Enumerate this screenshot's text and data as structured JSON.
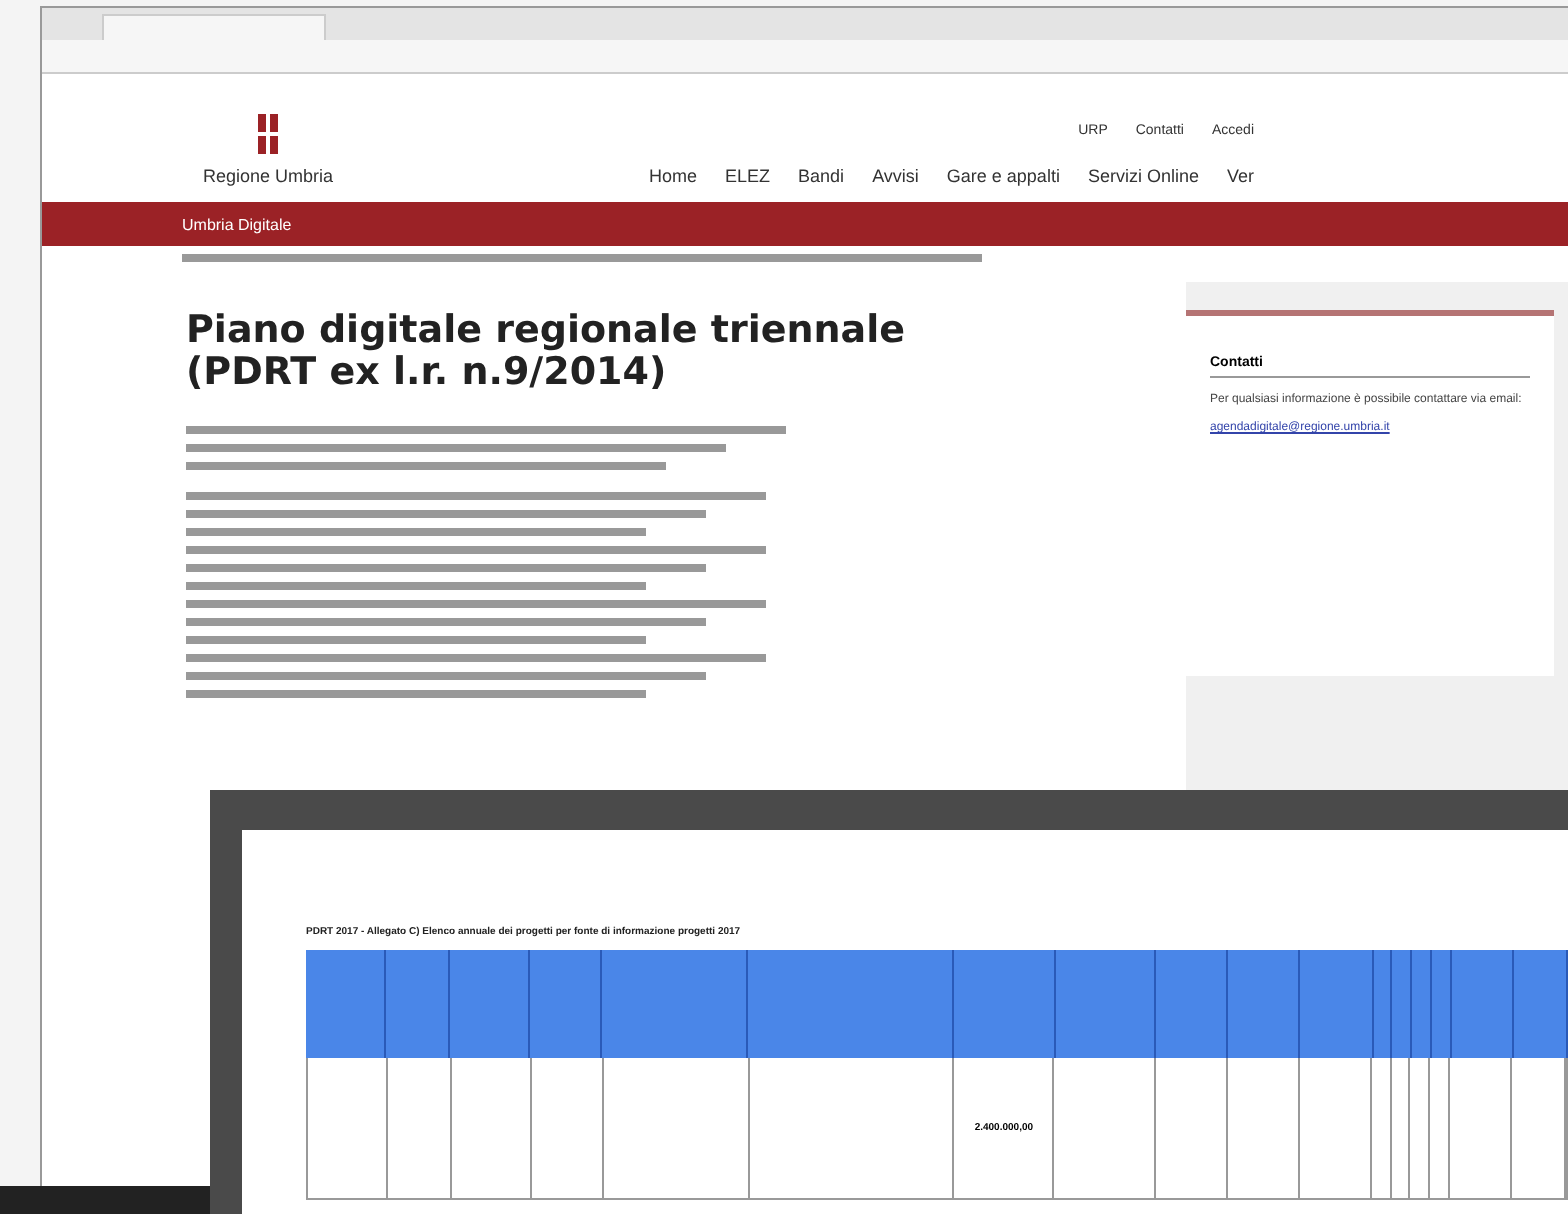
{
  "site": {
    "logo_text": "Regione Umbria",
    "top_links": [
      "URP",
      "Contatti",
      "Accedi"
    ],
    "nav": [
      "Home",
      "ELEZ",
      "Bandi",
      "Avvisi",
      "Gare e appalti",
      "Servizi Online",
      "Ver"
    ],
    "section_bar": "Umbria Digitale"
  },
  "article": {
    "title": "Piano digitale regionale triennale (PDRT ex l.r. n.9/2014)"
  },
  "sidebar": {
    "heading": "Contatti",
    "text": "Per qualsiasi informazione è possibile contattare via email:",
    "email": "agendadigitale@regione.umbria.it"
  },
  "document": {
    "title": "PDRT 2017 - Allegato C) Elenco annuale dei progetti per fonte di informazione progetti 2017",
    "amount": "2.400.000,00"
  }
}
